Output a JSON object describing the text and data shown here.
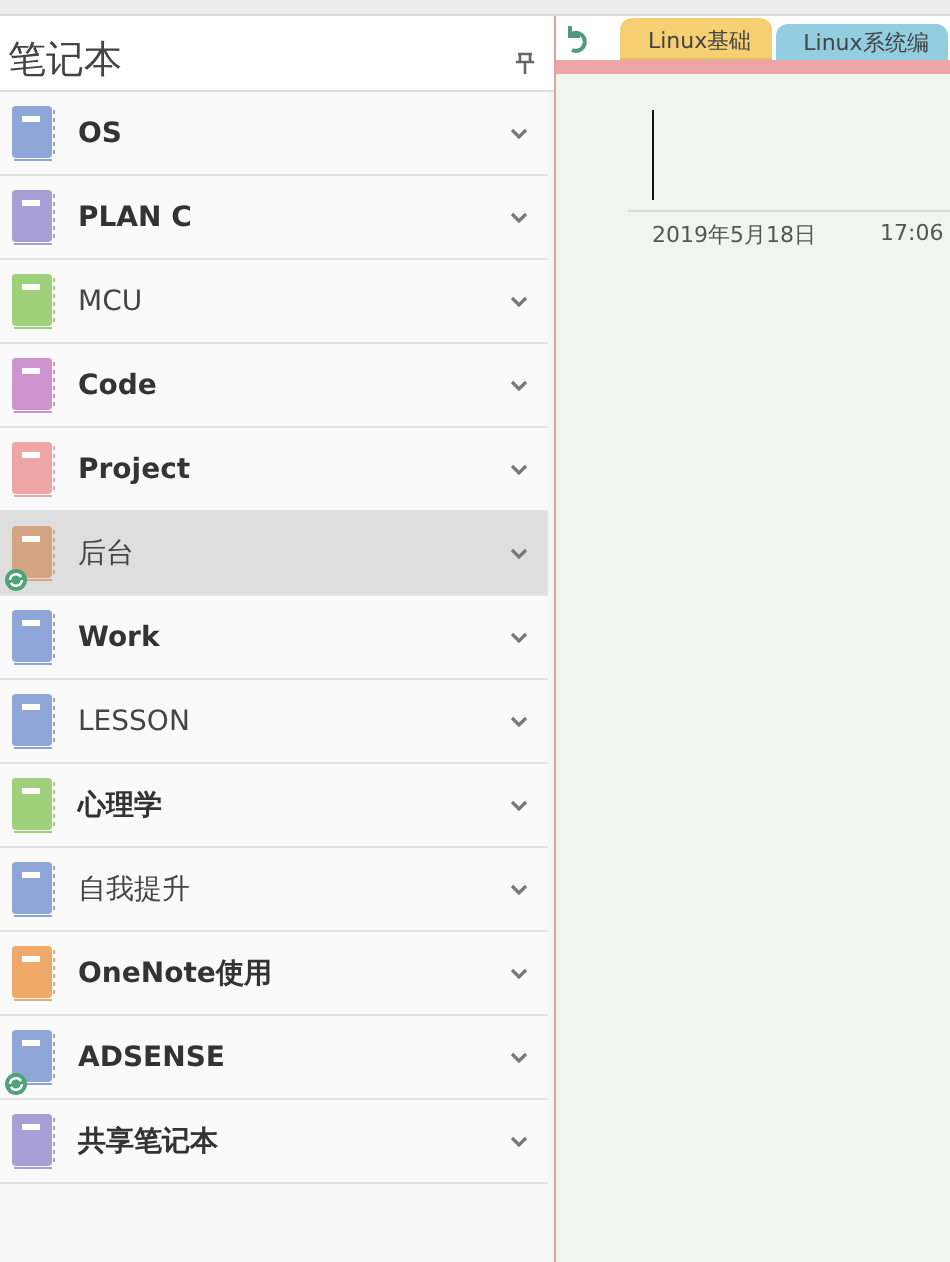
{
  "sidebar": {
    "title": "笔记本",
    "notebooks": [
      {
        "name": "OS",
        "color": "#8fa6d9",
        "unread": true,
        "syncing": false,
        "selected": false
      },
      {
        "name": "PLAN C",
        "color": "#a89fd6",
        "unread": true,
        "syncing": false,
        "selected": false
      },
      {
        "name": "MCU",
        "color": "#9fd07a",
        "unread": false,
        "syncing": false,
        "selected": false
      },
      {
        "name": "Code",
        "color": "#cf94cf",
        "unread": true,
        "syncing": false,
        "selected": false
      },
      {
        "name": "Project",
        "color": "#eea5a5",
        "unread": true,
        "syncing": false,
        "selected": false
      },
      {
        "name": "后台",
        "color": "#d5a483",
        "unread": false,
        "syncing": true,
        "selected": true
      },
      {
        "name": "Work",
        "color": "#8fa6d9",
        "unread": true,
        "syncing": false,
        "selected": false
      },
      {
        "name": "LESSON",
        "color": "#8fa6d9",
        "unread": false,
        "syncing": false,
        "selected": false
      },
      {
        "name": "心理学",
        "color": "#9fd07a",
        "unread": true,
        "syncing": false,
        "selected": false
      },
      {
        "name": "自我提升",
        "color": "#8fa6d9",
        "unread": false,
        "syncing": false,
        "selected": false
      },
      {
        "name": "OneNote使用",
        "color": "#efaa6a",
        "unread": true,
        "syncing": false,
        "selected": false
      },
      {
        "name": "ADSENSE",
        "color": "#8fa6d9",
        "unread": true,
        "syncing": true,
        "selected": false
      },
      {
        "name": "共享笔记本",
        "color": "#a89fd6",
        "unread": true,
        "syncing": false,
        "selected": false
      }
    ]
  },
  "section_tabs": [
    {
      "label": "Linux基础",
      "color": "#f6cf72",
      "selected": true
    },
    {
      "label": "Linux系统编",
      "color": "#92cde0",
      "selected": false
    }
  ],
  "page": {
    "date": "2019年5月18日",
    "time": "17:06"
  }
}
